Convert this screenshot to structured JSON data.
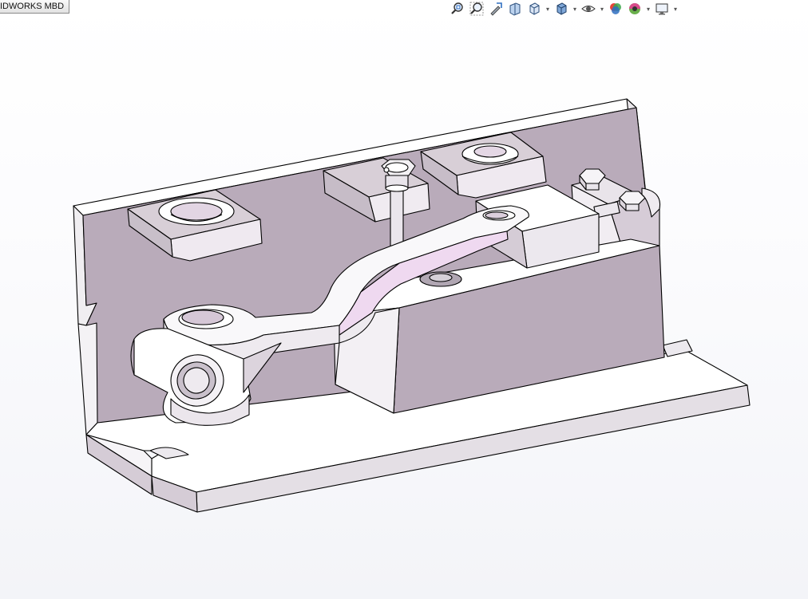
{
  "tab": {
    "label": "IDWORKS MBD"
  },
  "toolbar": {
    "buttons": [
      {
        "name": "zoom-to-fit-icon",
        "has_dropdown": false
      },
      {
        "name": "zoom-to-area-icon",
        "has_dropdown": false
      },
      {
        "name": "previous-view-icon",
        "has_dropdown": false
      },
      {
        "name": "section-view-icon",
        "has_dropdown": false
      },
      {
        "name": "view-orientation-icon",
        "has_dropdown": true
      },
      {
        "name": "display-style-icon",
        "has_dropdown": true
      },
      {
        "name": "hide-show-items-icon",
        "has_dropdown": true
      },
      {
        "name": "edit-appearance-icon",
        "has_dropdown": false
      },
      {
        "name": "apply-scene-icon",
        "has_dropdown": true
      },
      {
        "name": "view-settings-icon",
        "has_dropdown": true
      }
    ]
  },
  "colors": {
    "face_light": "#ffffff",
    "face_shade": "#d8cfd7",
    "face_mauve": "#b9abba",
    "face_pink": "#efd9f0",
    "edge": "#000000",
    "accent_blue": "#2f6fc1"
  }
}
